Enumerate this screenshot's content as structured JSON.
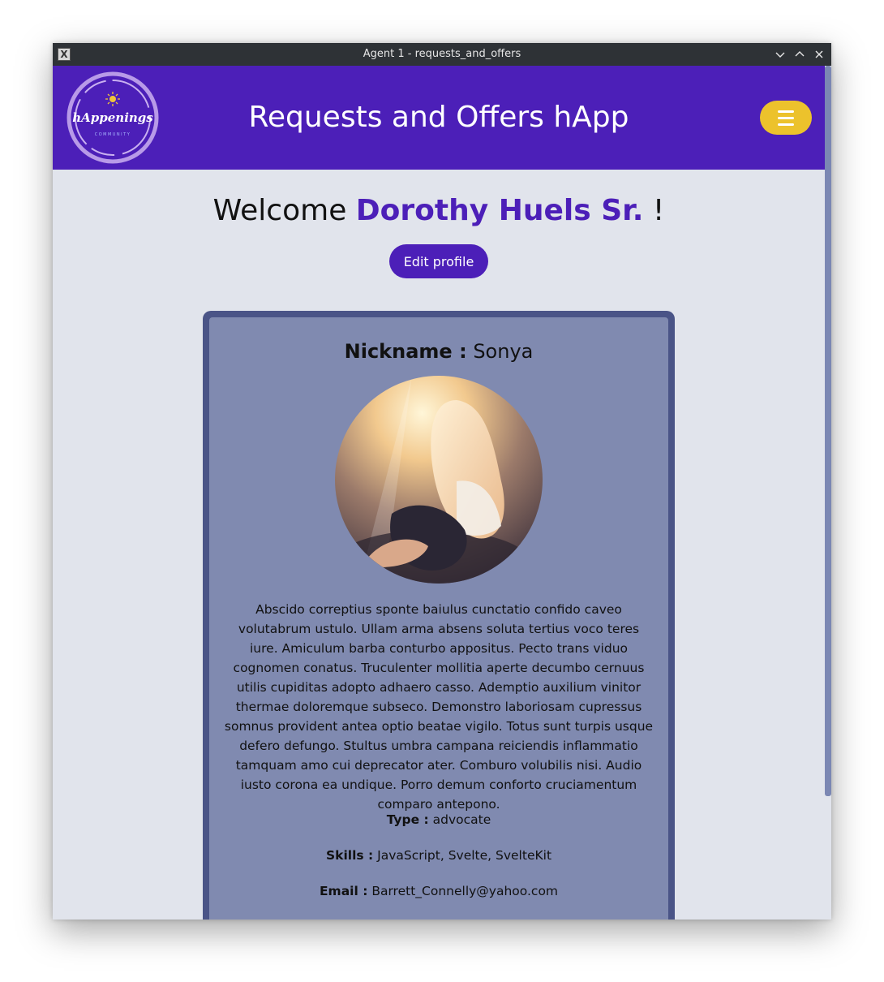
{
  "window": {
    "title": "Agent 1 - requests_and_offers",
    "icon": "x-app-icon",
    "controls": [
      "minimize-icon",
      "maximize-icon",
      "close-icon"
    ]
  },
  "header": {
    "title": "Requests and Offers hApp",
    "logo_text": "hAppenings",
    "logo_subtext": "COMMUNITY",
    "background": "#4c1fb8",
    "menu_button_color": "#ecc22c"
  },
  "welcome": {
    "prefix": "Welcome",
    "name": "Dorothy Huels Sr.",
    "suffix": "!"
  },
  "edit_profile_label": "Edit profile",
  "profile": {
    "nickname_label": "Nickname :",
    "nickname": "Sonya",
    "bio": "Abscido correptius sponte baiulus cunctatio confido caveo volutabrum ustulo. Ullam arma absens soluta tertius voco teres iure. Amiculum barba conturbo appositus. Pecto trans viduo cognomen conatus. Truculenter mollitia aperte decumbo cernuus utilis cupiditas adopto adhaero casso. Ademptio auxilium vinitor thermae doloremque subseco. Demonstro laboriosam cupressus somnus provident antea optio beatae vigilo. Totus sunt turpis usque defero defungo. Stultus umbra campana reiciendis inflammatio tamquam amo cui deprecator ater. Comburo volubilis nisi. Audio iusto corona ea undique. Porro demum conforto cruciamentum comparo antepono.",
    "type_label": "Type :",
    "type": "advocate",
    "skills_label": "Skills :",
    "skills": "JavaScript, Svelte, SvelteKit",
    "email_label": "Email :",
    "email": "Barrett_Connelly@yahoo.com"
  },
  "colors": {
    "accent": "#4c1fb8",
    "card_border": "#4a5487",
    "card_bg": "#808ab0",
    "page_bg": "#e1e4ec"
  }
}
